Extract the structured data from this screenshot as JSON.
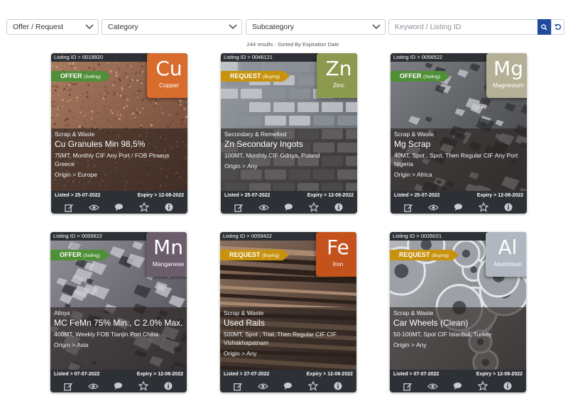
{
  "filters": {
    "offer_request": "Offer / Request",
    "category": "Category",
    "subcategory": "Subcategory",
    "search_placeholder": "Keyword / Listing ID"
  },
  "results": "244 results - Sorted By Expiration Date",
  "labels": {
    "listing_id_prefix": "Listing ID",
    "origin_prefix": "Origin",
    "listed_prefix": "Listed",
    "expiry_prefix": "Expiry",
    "sep": ">"
  },
  "colors": {
    "offer": "#4f8f37",
    "request": "#c7920d",
    "copper": "#d86c2c",
    "zinc": "#8c9a50",
    "magnesium": "#b3b096",
    "manganese": "#6c5d6c",
    "iron": "#c4521d",
    "aluminium": "#b0b7c1"
  },
  "listings": [
    {
      "id": "0019920",
      "type": "OFFER",
      "type_sub": "(Selling)",
      "symbol": "Cu",
      "element": "Copper",
      "category": "Scrap & Waste",
      "title": "Cu Granules Min 98,5%",
      "desc": "75MT, Monthly CIF Any Port / FOB Piraeus Greece",
      "origin": "Europe",
      "listed": "25-07-2022",
      "expiry": "12-08-2022"
    },
    {
      "id": "0046121",
      "type": "REQUEST",
      "type_sub": "(Buying)",
      "symbol": "Zn",
      "element": "Zinc",
      "category": "Secondary & Remelted",
      "title": "Zn Secondary Ingots",
      "desc": "100MT, Monthly CIF Gdnya, Poland",
      "origin": "Any",
      "listed": "25-07-2022",
      "expiry": "12-08-2022"
    },
    {
      "id": "0056522",
      "type": "OFFER",
      "type_sub": "(Selling)",
      "symbol": "Mg",
      "element": "Magnesium",
      "category": "Scrap & Waste",
      "title": "Mg Scrap",
      "desc": "40MT, Spot , Spot, Then Regular CIF Any Port Nigeria",
      "origin": "Africa",
      "listed": "25-07-2022",
      "expiry": "12-08-2022"
    },
    {
      "id": "0055622",
      "type": "OFFER",
      "type_sub": "(Selling)",
      "symbol": "Mn",
      "element": "Manganese",
      "category": "Alloys",
      "title": "MC FeMn 75% Min., C 2.0% Max.",
      "desc": "400MT, Weekly FOB Tianjin Port China",
      "origin": "Asia",
      "listed": "07-07-2022",
      "expiry": "12-08-2022"
    },
    {
      "id": "0059422",
      "type": "REQUEST",
      "type_sub": "(Buying)",
      "symbol": "Fe",
      "element": "Iron",
      "category": "Scrap & Waste",
      "title": "Used Rails",
      "desc": "500MT, Spot , Trial, Then Regular CIF CIF Vishakhapatnam",
      "origin": "Any",
      "listed": "27-07-2022",
      "expiry": "12-08-2022"
    },
    {
      "id": "0035021",
      "type": "REQUEST",
      "type_sub": "(Buying)",
      "symbol": "Al",
      "element": "Aluminium",
      "category": "Scrap & Waste",
      "title": "Car Wheels (Clean)",
      "desc": "50-100MT, Spot CIF Istanbul, Turkey",
      "origin": "Any",
      "listed": "07-07-2022",
      "expiry": "12-08-2022"
    }
  ]
}
